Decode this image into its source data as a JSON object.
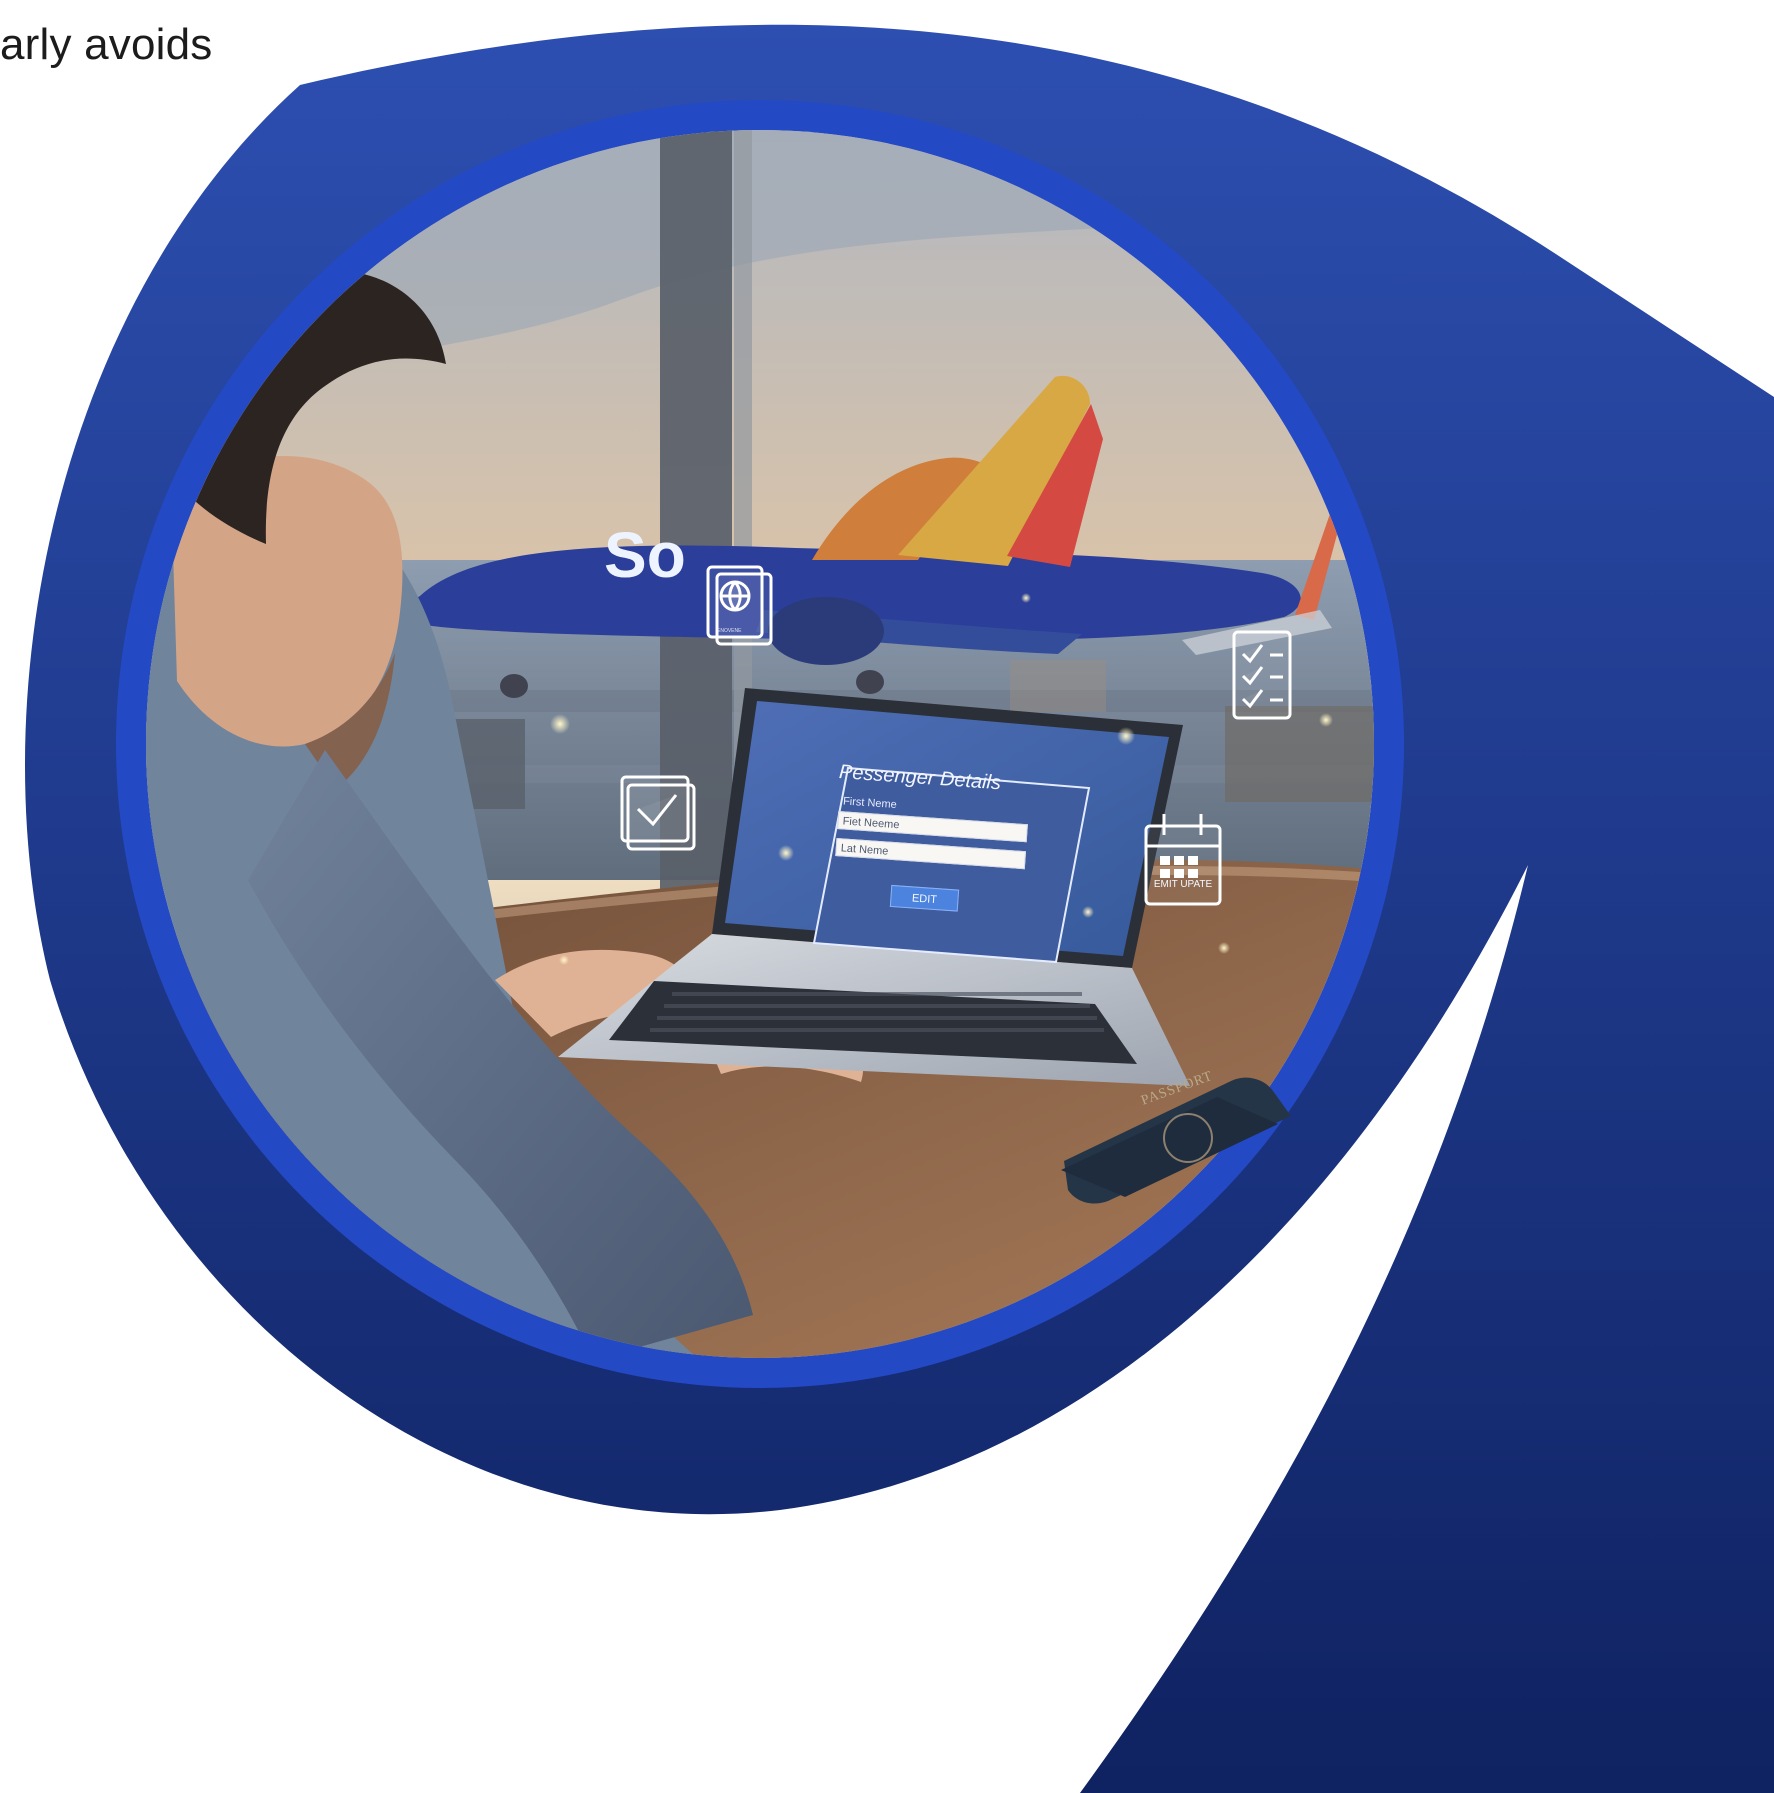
{
  "page": {
    "top_text": "arly avoids"
  },
  "laptop_screen": {
    "title": "Pessenger Details",
    "label": "First Neme",
    "first_input_value": "Fiet Neeme",
    "last_input_value": "Lat Neme",
    "button_label": "EDIT"
  },
  "floating_icons": {
    "calendar_label": "EMIT UPATE",
    "passport_mini_text": "ENOVENE"
  },
  "desk": {
    "passport_cover_text": "PASSPORT"
  },
  "aircraft": {
    "text": "So"
  },
  "colors": {
    "primary_blue": "#1f3ea6",
    "deep_blue": "#112774",
    "ring_blue": "#2c52c8",
    "accent_white": "#ffffff"
  }
}
